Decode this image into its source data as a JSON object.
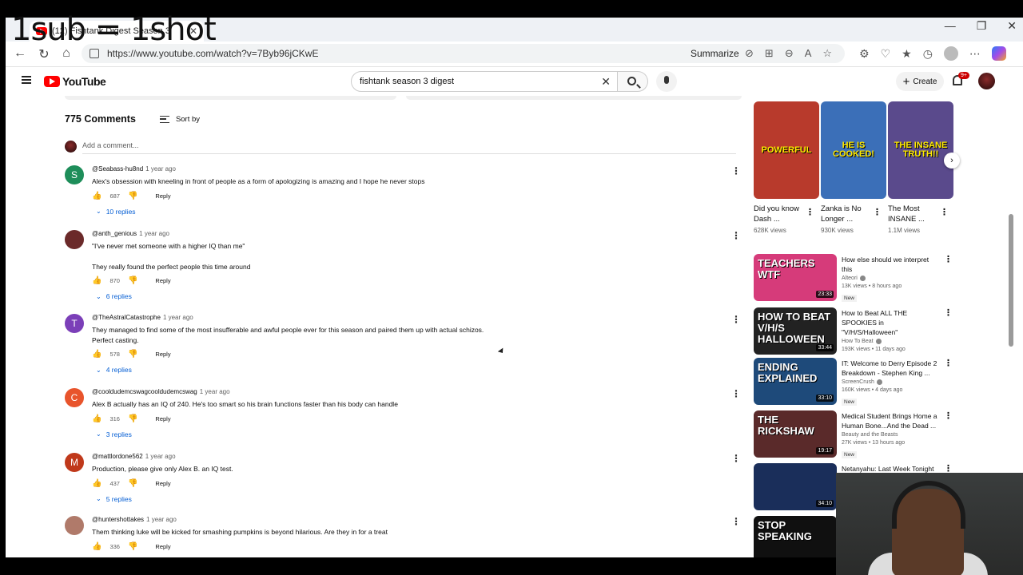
{
  "overlay": {
    "text": "1sub = 1shot"
  },
  "browser": {
    "tab_title": "(12) Fishtank Digest Season 3",
    "tab_close": "✕",
    "url": "https://www.youtube.com/watch?v=7Byb96jCKwE",
    "summarize_label": "Summarize",
    "window_controls": {
      "minimize": "—",
      "restore": "❐",
      "close": "✕"
    }
  },
  "youtube": {
    "logo_text": "YouTube",
    "search_value": "fishtank season 3 digest",
    "search_clear": "✕",
    "create_label": "Create",
    "notifications_badge": "9+"
  },
  "comments": {
    "count_label": "775 Comments",
    "sort_label": "Sort by",
    "add_placeholder": "Add a comment...",
    "reply_label": "Reply",
    "items": [
      {
        "avatar_letter": "S",
        "avatar_color": "#1e8e5a",
        "author": "@Seabass-hu8nd",
        "time": "1 year ago",
        "text": "Alex's obsession with kneeling in front of people as a form of apologizing is amazing and I hope he never stops",
        "likes": "687",
        "replies": "10 replies"
      },
      {
        "avatar_letter": "",
        "avatar_color": "#6b2a2a",
        "author": "@anth_genious",
        "time": "1 year ago",
        "text": "\"I've never met someone with a higher IQ than me\"",
        "text2": "They really found the perfect people this time around",
        "likes": "870",
        "replies": "6 replies"
      },
      {
        "avatar_letter": "T",
        "avatar_color": "#7b3fb8",
        "author": "@TheAstralCatastrophe",
        "time": "1 year ago",
        "text": "They managed to find some of the most insufferable and awful people ever for this season and paired them up with actual schizos.",
        "text2": "Perfect casting.",
        "likes": "578",
        "replies": "4 replies"
      },
      {
        "avatar_letter": "C",
        "avatar_color": "#e8542c",
        "author": "@cooldudemcswagcooldudemcswag",
        "time": "1 year ago",
        "text": "Alex B actually has an IQ of 240. He's too smart so his brain functions faster than his body can handle",
        "likes": "316",
        "replies": "3 replies"
      },
      {
        "avatar_letter": "M",
        "avatar_color": "#c0391b",
        "author": "@mattlordone562",
        "time": "1 year ago",
        "text": "Production, please give only Alex B. an IQ test.",
        "likes": "437",
        "replies": "5 replies"
      },
      {
        "avatar_letter": "",
        "avatar_color": "#b07a6a",
        "author": "@huntershottakes",
        "time": "1 year ago",
        "text": "Them thinking luke will be kicked for smashing pumpkins is beyond hilarious. Are they in for a treat",
        "likes": "336",
        "replies": ""
      }
    ]
  },
  "shorts": [
    {
      "title": "Did you know Dash ...",
      "views": "628K views",
      "overlay": "POWERFUL",
      "bg": "#b83a2c"
    },
    {
      "title": "Zanka is No Longer ...",
      "views": "930K views",
      "overlay": "HE IS COOKED!",
      "bg": "#3b6fb8"
    },
    {
      "title": "The Most INSANE ...",
      "views": "1.1M views",
      "overlay": "THE INSANE TRUTH!!",
      "bg": "#5a4a8c"
    }
  ],
  "videos": [
    {
      "title": "How else should we interpret this",
      "channel": "Alteori",
      "verified": true,
      "stats": "13K views • 8 hours ago",
      "badge": "New",
      "duration": "23:33",
      "thumb_text": "TEACHERS WTF",
      "bg": "#d63b7a"
    },
    {
      "title": "How to Beat ALL THE SPOOKIES in \"V/H/S/Halloween\"",
      "channel": "How To Beat",
      "verified": true,
      "stats": "193K views • 11 days ago",
      "badge": "",
      "duration": "33:44",
      "thumb_text": "HOW TO BEAT V/H/S HALLOWEEN",
      "bg": "#222"
    },
    {
      "title": "IT: Welcome to Derry Episode 2 Breakdown - Stephen King ...",
      "channel": "ScreenCrush",
      "verified": true,
      "stats": "160K views • 4 days ago",
      "badge": "New",
      "duration": "33:10",
      "thumb_text": "ENDING EXPLAINED",
      "bg": "#1e4a7a"
    },
    {
      "title": "Medical Student Brings Home a Human Bone...And the Dead ...",
      "channel": "Beauty and the Beasts",
      "verified": false,
      "stats": "27K views • 13 hours ago",
      "badge": "New",
      "duration": "19:17",
      "thumb_text": "THE RICKSHAW",
      "bg": "#5a2a2a"
    },
    {
      "title": "Netanyahu: Last Week Tonight ...",
      "channel": "",
      "verified": false,
      "stats": "",
      "badge": "",
      "duration": "34:10",
      "thumb_text": "",
      "bg": "#1a2e5a"
    },
    {
      "title": "",
      "channel": "",
      "verified": false,
      "stats": "",
      "badge": "",
      "duration": "",
      "thumb_text": "STOP SPEAKING",
      "bg": "#101010"
    }
  ]
}
